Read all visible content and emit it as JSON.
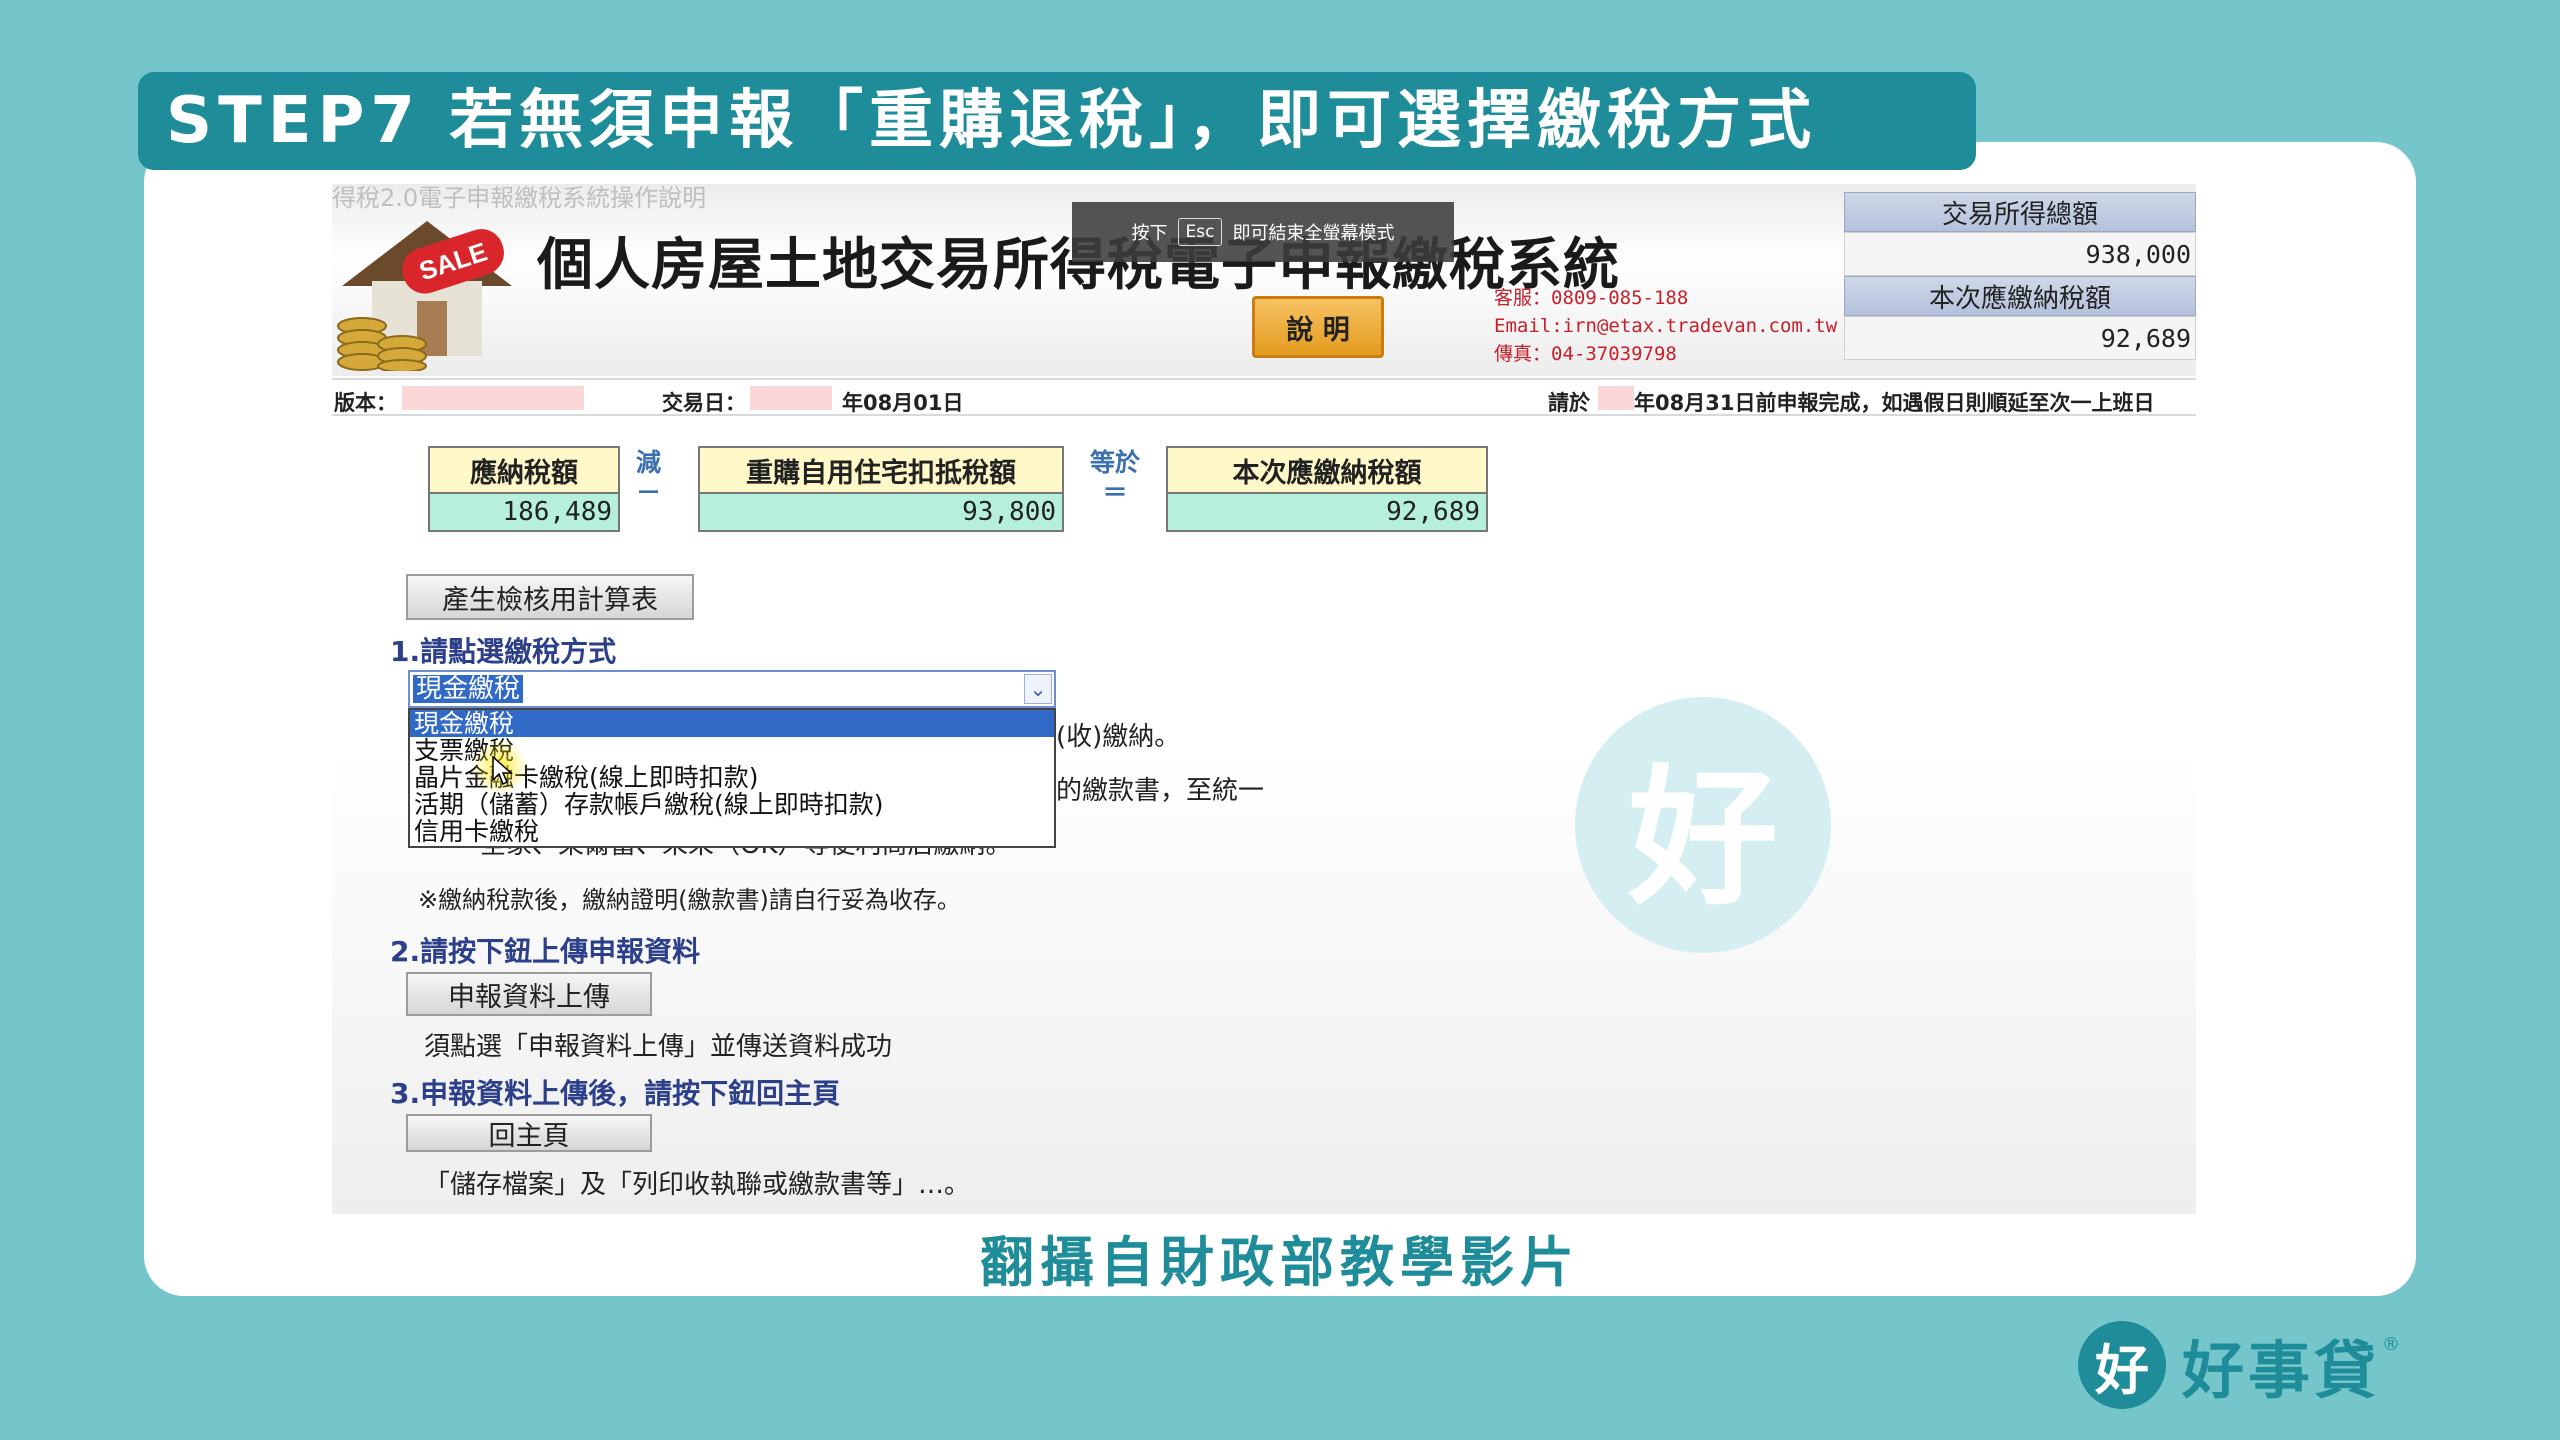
{
  "banner": {
    "title": "STEP7  若無須申報「重購退稅」，即可選擇繳稅方式"
  },
  "screenshot": {
    "faded_caption": "得稅2.0電子申報繳稅系統操作說明",
    "sale_sign": "SALE",
    "system_title": "個人房屋土地交易所得稅電子申報繳稅系統",
    "esc_overlay": {
      "prefix": "按下",
      "key": "Esc",
      "suffix": "即可結束全螢幕模式"
    },
    "help_button": "說 明",
    "contact": {
      "service": "客服：0809-085-188",
      "email": "Email:irn@etax.tradevan.com.tw",
      "fax": "傳真：04-37039798"
    },
    "summary": {
      "total_label": "交易所得總額",
      "total_value": "938,000",
      "payable_label": "本次應繳納稅額",
      "payable_value": "92,689"
    },
    "info_row": {
      "version_label": "版本：",
      "trade_date_label": "交易日：",
      "trade_date_value": "年08月01日",
      "deadline_prefix": "請於",
      "deadline_text": "年08月31日前申報完成，如遇假日則順延至次一上班日"
    },
    "calc": {
      "tax_due_label": "應納稅額",
      "tax_due_value": "186,489",
      "minus_label": "減",
      "minus_symbol": "－",
      "deduction_label": "重購自用住宅扣抵稅額",
      "deduction_value": "93,800",
      "equals_label": "等於",
      "equals_symbol": "＝",
      "payable_label": "本次應繳納稅額",
      "payable_value": "92,689"
    },
    "generate_button": "產生檢核用計算表",
    "section1": {
      "heading": "1.請點選繳稅方式",
      "selected_value": "現金繳稅",
      "options": [
        "現金繳稅",
        "支票繳稅",
        "晶片金融卡繳稅(線上即時扣款)",
        "活期（儲蓄）存款帳戶繳稅(線上即時扣款)",
        "信用卡繳稅"
      ],
      "hidden_line1_tail": "(收)繳納。",
      "hidden_line2_tail": "的繳款書，至統一",
      "hidden_line3_head": "全家、萊爾富、來來（OK）等便利商店繳納。",
      "footnote": "※繳納稅款後，繳納證明(繳款書)請自行妥為收存。"
    },
    "section2": {
      "heading": "2.請按下鈕上傳申報資料",
      "button": "申報資料上傳",
      "note": "須點選「申報資料上傳」並傳送資料成功"
    },
    "section3": {
      "heading": "3.申報資料上傳後，請按下鈕回主頁",
      "button": "回主頁",
      "note": "「儲存檔案」及「列印收執聯或繳款書等」…。"
    }
  },
  "watermark_char": "好",
  "source_caption": "翻攝自財政部教學影片",
  "brand": {
    "icon_char": "好",
    "name": "好事貸",
    "reg": "®"
  },
  "colors": {
    "background": "#74c6cb",
    "accent": "#1f8c9a",
    "heading": "#2c3f8a",
    "contact": "#c8202a"
  }
}
